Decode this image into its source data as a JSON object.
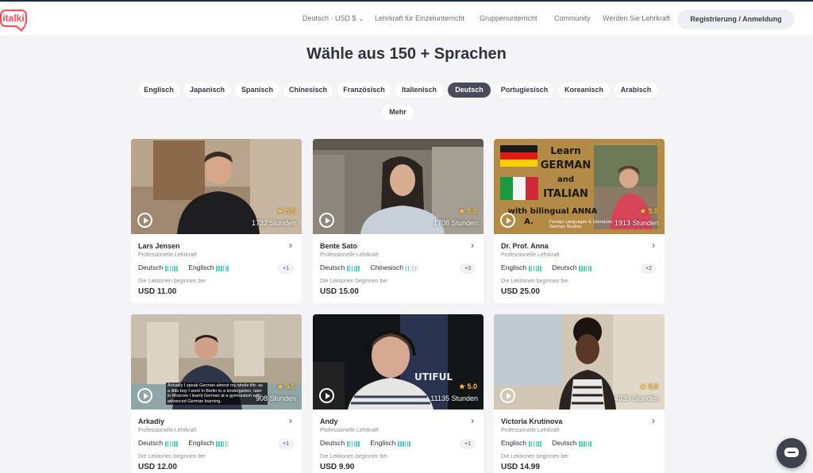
{
  "brand": {
    "logo_text": "italki",
    "accent": "#ff4b55"
  },
  "nav": {
    "locale": "Deutsch · USD $",
    "items": [
      "Lehrkraft für Einzelunterricht",
      "Gruppenunterricht",
      "Community",
      "Werden Sie Lehrkraft"
    ],
    "auth_button": "Registrierung / Anmeldung"
  },
  "headline": "Wähle aus 150 + Sprachen",
  "languages": {
    "items": [
      "Englisch",
      "Japanisch",
      "Spanisch",
      "Chinesisch",
      "Französisch",
      "Italienisch",
      "Deutsch",
      "Portugiesisch",
      "Koreanisch",
      "Arabisch",
      "Mehr"
    ],
    "selected": "Deutsch"
  },
  "teachers": [
    {
      "name": "Lars Jensen",
      "title": "Professionelle Lehrkraft",
      "rating": "5.0",
      "hours": "1732 Stunden",
      "langs": [
        {
          "name": "Deutsch",
          "level": 6
        },
        {
          "name": "Englisch",
          "level": 6
        }
      ],
      "more": "+1",
      "from_label": "Die Lektionen beginnen bei",
      "price": "USD 11.00"
    },
    {
      "name": "Bente Sato",
      "title": "Professionelle Lehrkraft",
      "rating": "5.0",
      "hours": "1708 Stunden",
      "langs": [
        {
          "name": "Deutsch",
          "level": 6
        },
        {
          "name": "Chinesisch",
          "level": 2
        }
      ],
      "more": "+3",
      "from_label": "Die Lektionen beginnen bei",
      "price": "USD 15.00"
    },
    {
      "name": "Dr. Prof. Anna",
      "title": "Professionelle Lehrkraft",
      "rating": "5.0",
      "hours": "1913 Stunden",
      "langs": [
        {
          "name": "Englisch",
          "level": 6
        },
        {
          "name": "Deutsch",
          "level": 6
        }
      ],
      "more": "+2",
      "from_label": "Die Lektionen beginnen bei",
      "price": "USD 25.00",
      "promo": {
        "line1": "Learn",
        "line2": "GERMAN",
        "line3": "and",
        "line4": "ITALIAN",
        "line5": "with bilingual ANNA",
        "line6": "A.",
        "small": "Foreign Languages & Literature German Studies"
      }
    },
    {
      "name": "Arkadiy",
      "title": "Professionelle Lehrkraft",
      "rating": "5.0",
      "hours": "908 Stunden",
      "langs": [
        {
          "name": "Deutsch",
          "level": 6
        },
        {
          "name": "Englisch",
          "level": 5
        }
      ],
      "more": "+1",
      "from_label": "Die Lektionen beginnen bei",
      "price": "USD 12.00",
      "caption": "Actually I speak German almost my whole life: as a little boy I went in Berlin to a kindergarten, later in Moscow I learnt German at a gymnasium with advanced German learning."
    },
    {
      "name": "Andy",
      "title": "Professionelle Lehrkraft",
      "rating": "5.0",
      "hours": "11135 Stunden",
      "langs": [
        {
          "name": "Deutsch",
          "level": 6
        },
        {
          "name": "Englisch",
          "level": 6
        }
      ],
      "more": "+1",
      "from_label": "Die Lektionen beginnen bei",
      "price": "USD 9.90",
      "poster_text": "UTIFUL"
    },
    {
      "name": "Victoria Krutinova",
      "title": "Professionelle Lehrkraft",
      "rating": "5.0",
      "hours": "4920 Stunden",
      "langs": [
        {
          "name": "Englisch",
          "level": 6
        },
        {
          "name": "Deutsch",
          "level": 6
        }
      ],
      "more": "",
      "from_label": "Die Lektionen beginnen bei",
      "price": "USD 14.99"
    }
  ],
  "colors": {
    "level_bar": "#4ed3bd",
    "rating_star": "#ffc33d",
    "active_pill": "#4a4b5a"
  }
}
